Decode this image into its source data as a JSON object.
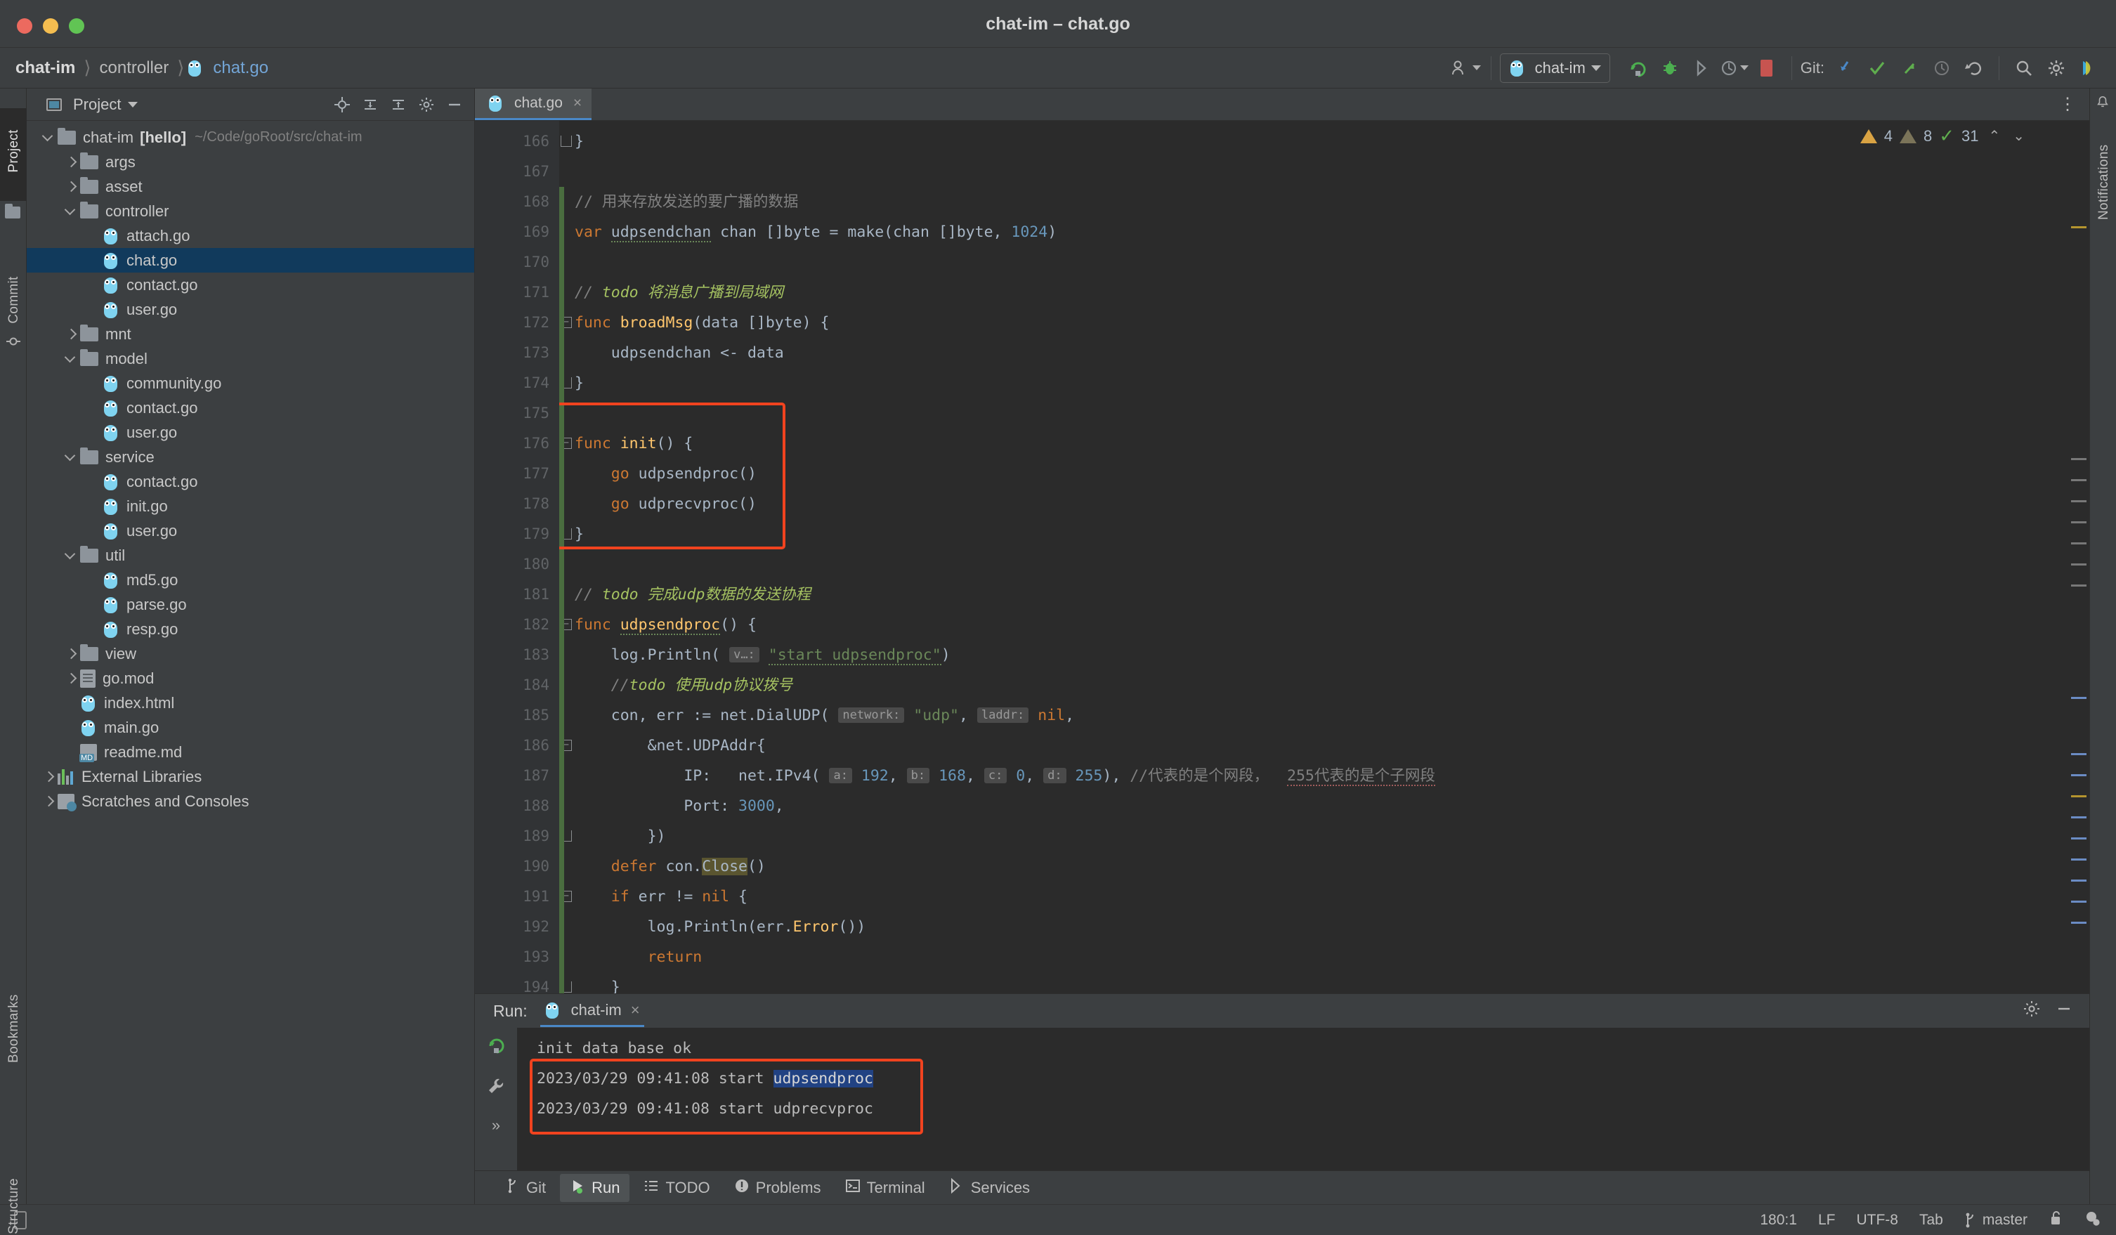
{
  "window": {
    "title": "chat-im – chat.go"
  },
  "breadcrumb": {
    "project": "chat-im",
    "folder": "controller",
    "file": "chat.go",
    "file_icon": "go-file-icon"
  },
  "toolbar": {
    "account_icon": "user-account-icon",
    "run_config": "chat-im",
    "run_icon": "run-icon",
    "debug_icon": "debug-icon",
    "coverage_icon": "run-with-coverage-icon",
    "profile_icon": "profile-icon",
    "stop_icon": "stop-icon",
    "git_label": "Git:",
    "update_icon": "git-update-icon",
    "commit_icon": "git-commit-icon",
    "push_icon": "git-push-icon",
    "history_icon": "git-history-icon",
    "rollback_icon": "git-rollback-icon",
    "search_icon": "search-everywhere-icon",
    "settings_icon": "settings-gear-icon",
    "plugin_icon": "ide-plugin-icon"
  },
  "left_rail": {
    "project": "Project",
    "commit": "Commit",
    "bookmarks": "Bookmarks",
    "structure": "Structure"
  },
  "right_rail": {
    "notifications": "Notifications"
  },
  "project_pane": {
    "title": "Project",
    "icons": [
      "locate-icon",
      "expand-all-icon",
      "collapse-all-icon",
      "settings-gear-icon",
      "hide-icon"
    ],
    "tree": [
      {
        "label": "chat-im",
        "badge": "[hello]",
        "path": "~/Code/goRoot/src/chat-im",
        "icon": "folder-icon",
        "arrow": "down",
        "indent": 0
      },
      {
        "label": "args",
        "icon": "folder-icon",
        "arrow": "right",
        "indent": 1
      },
      {
        "label": "asset",
        "icon": "folder-icon",
        "arrow": "right",
        "indent": 1
      },
      {
        "label": "controller",
        "icon": "folder-icon",
        "arrow": "down",
        "indent": 1
      },
      {
        "label": "attach.go",
        "icon": "go-file-icon",
        "arrow": "none",
        "indent": 2
      },
      {
        "label": "chat.go",
        "icon": "go-file-icon",
        "arrow": "none",
        "indent": 2,
        "selected": true
      },
      {
        "label": "contact.go",
        "icon": "go-file-icon",
        "arrow": "none",
        "indent": 2
      },
      {
        "label": "user.go",
        "icon": "go-file-icon",
        "arrow": "none",
        "indent": 2
      },
      {
        "label": "mnt",
        "icon": "folder-icon",
        "arrow": "right",
        "indent": 1
      },
      {
        "label": "model",
        "icon": "folder-icon",
        "arrow": "down",
        "indent": 1
      },
      {
        "label": "community.go",
        "icon": "go-file-icon",
        "arrow": "none",
        "indent": 2
      },
      {
        "label": "contact.go",
        "icon": "go-file-icon",
        "arrow": "none",
        "indent": 2
      },
      {
        "label": "user.go",
        "icon": "go-file-icon",
        "arrow": "none",
        "indent": 2
      },
      {
        "label": "service",
        "icon": "folder-icon",
        "arrow": "down",
        "indent": 1
      },
      {
        "label": "contact.go",
        "icon": "go-file-icon",
        "arrow": "none",
        "indent": 2
      },
      {
        "label": "init.go",
        "icon": "go-file-icon",
        "arrow": "none",
        "indent": 2
      },
      {
        "label": "user.go",
        "icon": "go-file-icon",
        "arrow": "none",
        "indent": 2
      },
      {
        "label": "util",
        "icon": "folder-icon",
        "arrow": "down",
        "indent": 1
      },
      {
        "label": "md5.go",
        "icon": "go-file-icon",
        "arrow": "none",
        "indent": 2
      },
      {
        "label": "parse.go",
        "icon": "go-file-icon",
        "arrow": "none",
        "indent": 2
      },
      {
        "label": "resp.go",
        "icon": "go-file-icon",
        "arrow": "none",
        "indent": 2
      },
      {
        "label": "view",
        "icon": "folder-icon",
        "arrow": "right",
        "indent": 1
      },
      {
        "label": "go.mod",
        "icon": "document-icon",
        "arrow": "right",
        "indent": 1
      },
      {
        "label": "index.html",
        "icon": "go-file-icon",
        "arrow": "none",
        "indent": 1
      },
      {
        "label": "main.go",
        "icon": "go-file-icon",
        "arrow": "none",
        "indent": 1
      },
      {
        "label": "readme.md",
        "icon": "markdown-icon",
        "arrow": "none",
        "indent": 1
      },
      {
        "label": "External Libraries",
        "icon": "libraries-icon",
        "arrow": "right",
        "indent": 0
      },
      {
        "label": "Scratches and Consoles",
        "icon": "scratches-icon",
        "arrow": "right",
        "indent": 0
      }
    ]
  },
  "editor": {
    "tab": {
      "label": "chat.go",
      "icon": "go-file-icon",
      "close": "×"
    },
    "more_icon": "more-options-icon",
    "inspection": {
      "warnings": "4",
      "weak_warnings": "8",
      "typos": "31",
      "up": "⌃",
      "down": "⌄"
    },
    "first_line": 166,
    "lines": [
      {
        "n": 166,
        "fold": "end",
        "text": "}"
      },
      {
        "n": 167,
        "text": ""
      },
      {
        "n": 168,
        "text": "// 用来存放发送的要广播的数据",
        "kind": "comment"
      },
      {
        "n": 169,
        "text": "var udpsendchan chan []byte = make(chan []byte, 1024)"
      },
      {
        "n": 170,
        "text": ""
      },
      {
        "n": 171,
        "text": "// todo 将消息广播到局域网",
        "kind": "comment-todo"
      },
      {
        "n": 172,
        "fold": "start",
        "text": "func broadMsg(data []byte) {"
      },
      {
        "n": 173,
        "text": "    udpsendchan <- data"
      },
      {
        "n": 174,
        "fold": "end",
        "text": "}"
      },
      {
        "n": 175,
        "text": ""
      },
      {
        "n": 176,
        "fold": "start",
        "text": "func init() {"
      },
      {
        "n": 177,
        "text": "    go udpsendproc()"
      },
      {
        "n": 178,
        "text": "    go udprecvproc()"
      },
      {
        "n": 179,
        "fold": "end",
        "text": "}"
      },
      {
        "n": 180,
        "text": ""
      },
      {
        "n": 181,
        "text": "// todo 完成udp数据的发送协程",
        "kind": "comment-todo"
      },
      {
        "n": 182,
        "fold": "start",
        "text": "func udpsendproc() {"
      },
      {
        "n": 183,
        "text": "    log.Println( v...: \"start udpsendproc\")"
      },
      {
        "n": 184,
        "text": "    //todo 使用udp协议拨号",
        "kind": "comment-todo"
      },
      {
        "n": 185,
        "text": "    con, err := net.DialUDP( network: \"udp\", laddr: nil,"
      },
      {
        "n": 186,
        "fold": "start",
        "text": "        &net.UDPAddr{"
      },
      {
        "n": 187,
        "text": "            IP:   net.IPv4( a: 192, b: 168, c: 0, d: 255), //代表的是个网段，255代表的是个子网段"
      },
      {
        "n": 188,
        "text": "            Port: 3000,"
      },
      {
        "n": 189,
        "fold": "end",
        "text": "        })"
      },
      {
        "n": 190,
        "text": "    defer con.Close()"
      },
      {
        "n": 191,
        "fold": "start",
        "text": "    if err != nil {"
      },
      {
        "n": 192,
        "text": "        log.Println(err.Error())"
      },
      {
        "n": 193,
        "text": "        return"
      },
      {
        "n": 194,
        "fold": "end",
        "text": "    }"
      }
    ],
    "annotation": {
      "color": "#f1431f",
      "target": "init-function-block"
    }
  },
  "run_pane": {
    "label": "Run:",
    "tab": "chat-im",
    "tab_close": "×",
    "settings_icon": "settings-gear-icon",
    "hide_icon": "hide-icon",
    "side_icons": [
      "rerun-icon",
      "wrench-icon",
      "expand-icon"
    ],
    "console": [
      {
        "text": "init data base ok"
      },
      {
        "text": "2023/03/29 09:41:08 start ",
        "highlight": "udpsendproc"
      },
      {
        "text": "2023/03/29 09:41:08 start udprecvproc"
      }
    ],
    "annotation_color": "#f1431f"
  },
  "tool_strip": {
    "items": [
      {
        "label": "Git",
        "icon": "git-branch-icon"
      },
      {
        "label": "Run",
        "icon": "run-icon",
        "active": true
      },
      {
        "label": "TODO",
        "icon": "todo-list-icon"
      },
      {
        "label": "Problems",
        "icon": "problems-icon"
      },
      {
        "label": "Terminal",
        "icon": "terminal-icon"
      },
      {
        "label": "Services",
        "icon": "services-icon"
      }
    ]
  },
  "status_bar": {
    "device_icon": "device-manager-icon",
    "caret": "180:1",
    "line_sep": "LF",
    "encoding": "UTF-8",
    "indent": "Tab",
    "branch_icon": "git-branch-icon",
    "branch": "master",
    "lock_icon": "unlocked-icon",
    "inspection_icon": "inspection-widget-icon"
  }
}
